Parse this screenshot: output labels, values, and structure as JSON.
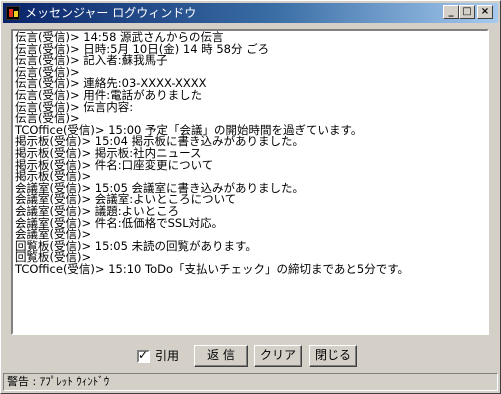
{
  "window": {
    "title": "メッセンジャー ログウィンドウ",
    "buttons": {
      "minimize": "_",
      "maximize": "□",
      "close": "×"
    }
  },
  "log": {
    "lines": [
      "伝言(受信)> 14:58 源武さんからの伝言",
      "伝言(受信)> 日時:5月 10日(金) 14 時 58分 ごろ",
      "伝言(受信)> 記入者:蘇我馬子",
      "伝言(受信)>",
      "伝言(受信)> 連絡先:03-XXXX-XXXX",
      "伝言(受信)> 用件:電話がありました",
      "伝言(受信)> 伝言内容:",
      "伝言(受信)>",
      "TCOffice(受信)> 15:00 予定「会議」の開始時間を過ぎています。",
      "掲示板(受信)> 15:04 掲示板に書き込みがありました。",
      "掲示板(受信)> 掲示板:社内ニュース",
      "掲示板(受信)> 件名:口座変更について",
      "掲示板(受信)>",
      "会議室(受信)> 15:05 会議室に書き込みがありました。",
      "会議室(受信)> 会議室:よいところについて",
      "会議室(受信)> 議題:よいところ",
      "会議室(受信)> 件名:低価格でSSL対応。",
      "会議室(受信)>",
      "回覧板(受信)> 15:05 未読の回覧があります。",
      "回覧板(受信)>",
      "TCOffice(受信)> 15:10 ToDo「支払いチェック」の締切まであと5分です。"
    ]
  },
  "controls": {
    "quote_checkbox_label": "引用",
    "quote_checked": true,
    "reply_button": "返 信",
    "clear_button": "クリア",
    "close_button": "閉じる"
  },
  "status": {
    "text": "警告 : ｱﾌﾟﾚｯﾄ ｳｨﾝﾄﾞｳ"
  }
}
